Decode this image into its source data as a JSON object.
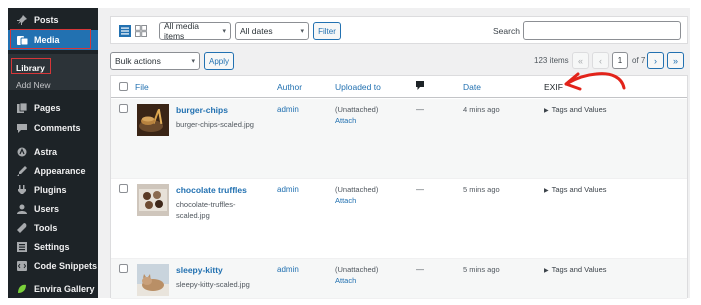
{
  "sidebar": {
    "items": [
      {
        "label": "Posts",
        "icon": "pin-icon"
      },
      {
        "label": "Media",
        "icon": "media-icon"
      },
      {
        "label": "Pages",
        "icon": "pages-icon"
      },
      {
        "label": "Comments",
        "icon": "comments-icon"
      },
      {
        "label": "Astra",
        "icon": "astra-icon"
      },
      {
        "label": "Appearance",
        "icon": "appearance-icon"
      },
      {
        "label": "Plugins",
        "icon": "plugins-icon"
      },
      {
        "label": "Users",
        "icon": "users-icon"
      },
      {
        "label": "Tools",
        "icon": "tools-icon"
      },
      {
        "label": "Settings",
        "icon": "settings-icon"
      },
      {
        "label": "Code Snippets",
        "icon": "code-snippets-icon"
      },
      {
        "label": "Envira Gallery",
        "icon": "envira-icon"
      }
    ],
    "submenu": {
      "library": "Library",
      "add_new": "Add New"
    }
  },
  "toolbar": {
    "media_filter": "All media items",
    "date_filter": "All dates",
    "filter_button": "Filter",
    "search_label": "Search",
    "bulk_actions": "Bulk actions",
    "apply_button": "Apply"
  },
  "pagination": {
    "items_count": "123 items",
    "first": "«",
    "prev": "‹",
    "current_page": "1",
    "of_pages": "of 7",
    "next": "›",
    "last": "»"
  },
  "table": {
    "headers": {
      "file": "File",
      "author": "Author",
      "uploaded_to": "Uploaded to",
      "date": "Date",
      "exif": "EXIF"
    },
    "rows": [
      {
        "title": "burger-chips",
        "filename": "burger-chips-scaled.jpg",
        "author": "admin",
        "uploaded": "(Unattached)",
        "attach": "Attach",
        "comments": "—",
        "date": "4 mins ago",
        "exif": "Tags and Values"
      },
      {
        "title": "chocolate truffles",
        "filename": "chocolate-truffles-scaled.jpg",
        "author": "admin",
        "uploaded": "(Unattached)",
        "attach": "Attach",
        "comments": "—",
        "date": "5 mins ago",
        "exif": "Tags and Values"
      },
      {
        "title": "sleepy-kitty",
        "filename": "sleepy-kitty-scaled.jpg",
        "author": "admin",
        "uploaded": "(Unattached)",
        "attach": "Attach",
        "comments": "—",
        "date": "5 mins ago",
        "exif": "Tags and Values"
      }
    ]
  },
  "colors": {
    "sidebar_bg": "#1d2327",
    "accent": "#2271b1",
    "highlight_red": "#d63638"
  }
}
